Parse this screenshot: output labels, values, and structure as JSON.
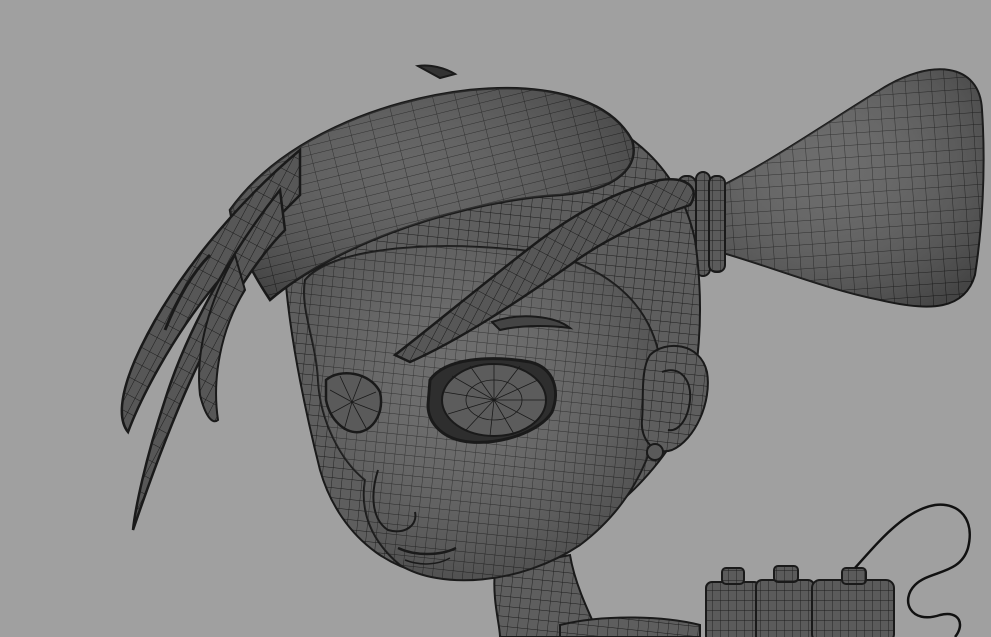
{
  "viewport": {
    "background": "#a0a0a0",
    "model": {
      "name": "character-head",
      "display": "wireframe-on-shaded",
      "surface_color": "#585858",
      "surface_light": "#6a6a6a",
      "surface_dark": "#3c3c3c",
      "wire_color": "#1a1a1a"
    },
    "parts": [
      "face",
      "headband",
      "hair-bangs",
      "ponytail",
      "hair-tie",
      "ear",
      "eye-left",
      "eye-right",
      "eyebrow",
      "neck",
      "spray-cans",
      "cable"
    ]
  }
}
